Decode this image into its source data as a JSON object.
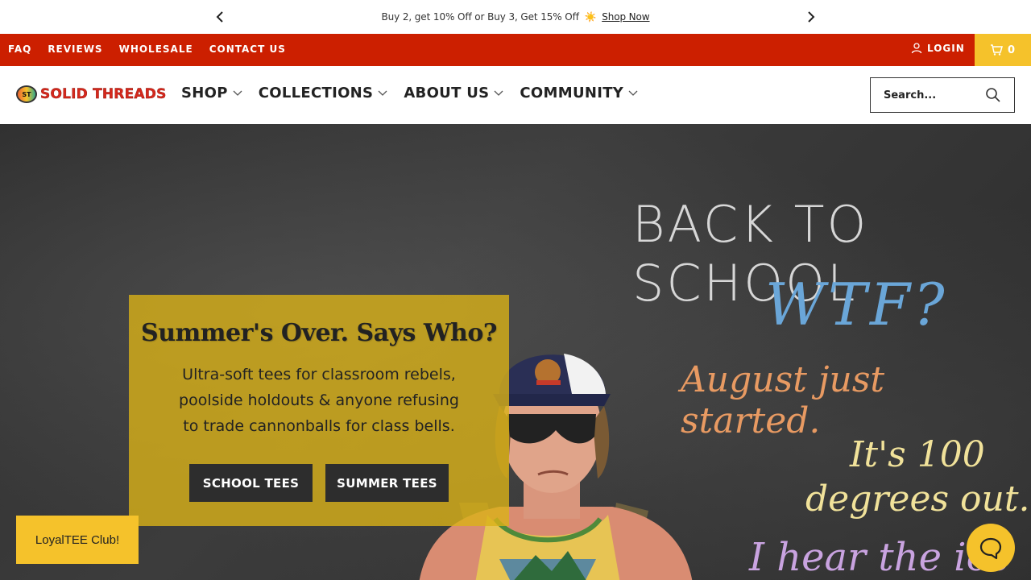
{
  "announcement": {
    "text": "Buy 2, get 10% Off or Buy 3, Get 15% Off",
    "emoji": "☀️",
    "link_label": "Shop Now"
  },
  "topbar": {
    "links": [
      "FAQ",
      "REVIEWS",
      "WHOLESALE",
      "CONTACT US"
    ],
    "login_label": "LOGIN",
    "cart_count": "0",
    "bg_color": "#cc1f00",
    "cart_color": "#f5c22b"
  },
  "header": {
    "logo_text": "SOLID THREADS",
    "logo_badge": "ST",
    "nav": [
      "SHOP",
      "COLLECTIONS",
      "ABOUT US",
      "COMMUNITY"
    ],
    "search_placeholder": "Search..."
  },
  "hero": {
    "chalk_lines": [
      "BACK TO SCHOOL",
      "WTF?",
      "August just started.",
      "It's 100",
      "degrees out.",
      "I hear the ice"
    ],
    "title": "Summer's Over. Says Who?",
    "subtitle_lines": [
      "Ultra-soft tees for classroom rebels,",
      "poolside holdouts & anyone refusing",
      "to trade cannonballs for class bells."
    ],
    "buttons": [
      "SCHOOL TEES",
      "SUMMER TEES"
    ]
  },
  "widgets": {
    "loyalty_label": "LoyalTEE Club!",
    "help_icon": "chat-bubble-icon"
  }
}
